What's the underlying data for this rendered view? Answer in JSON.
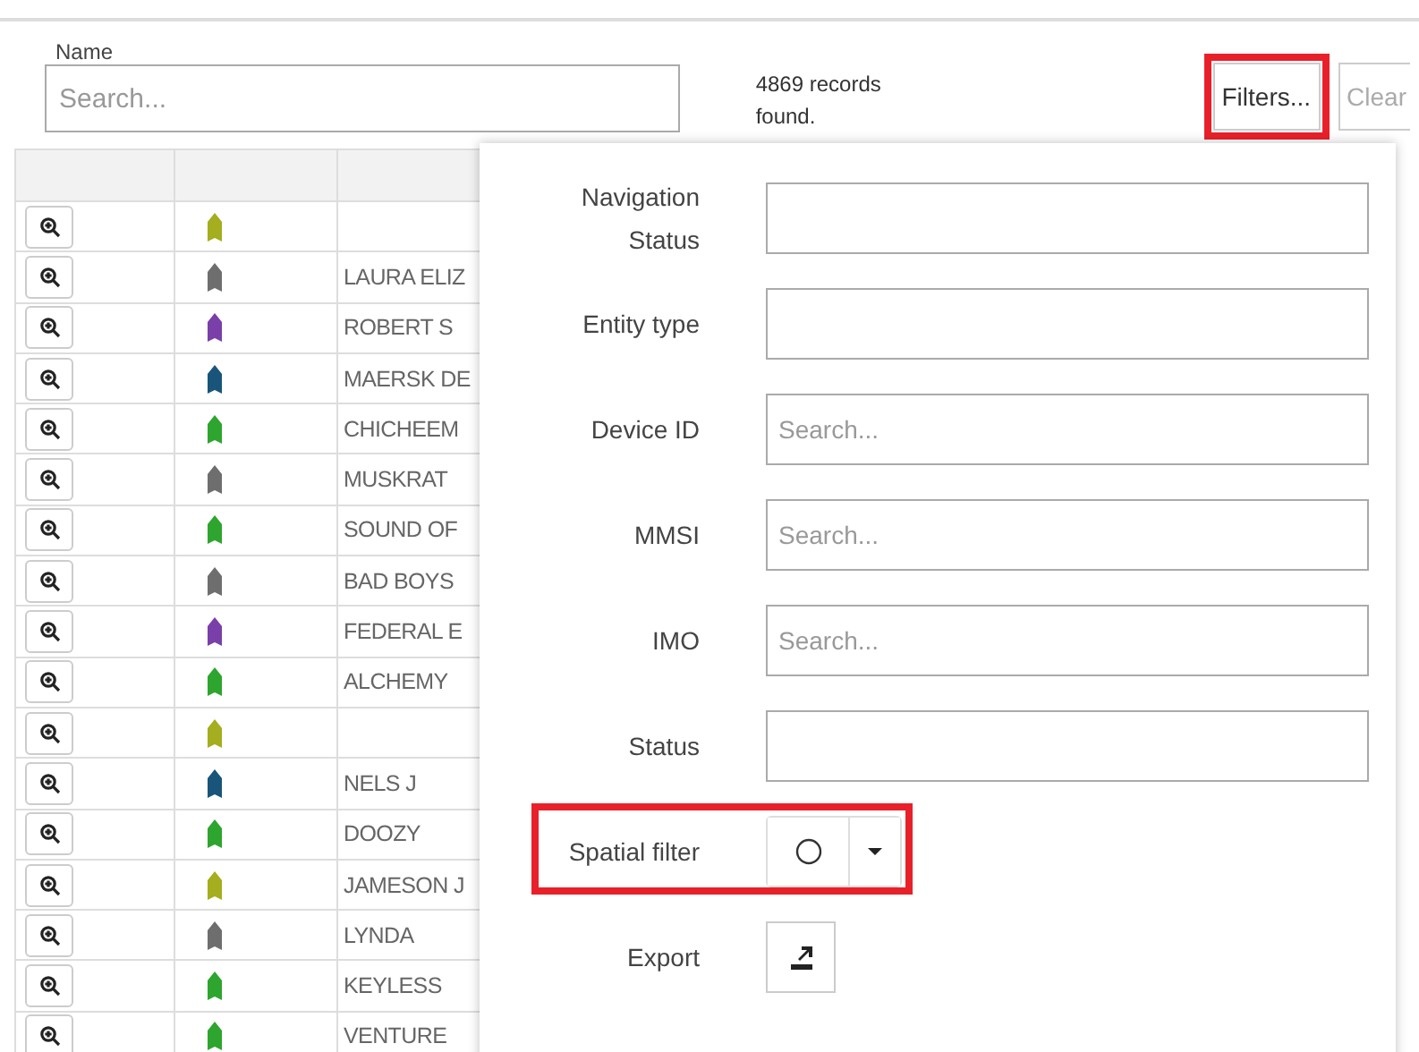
{
  "name_filter": {
    "label": "Name",
    "placeholder": "Search..."
  },
  "records": "4869 records found.",
  "toolbar": [
    {
      "label": "Filters...",
      "highlighted": true
    },
    {
      "label": "Clear",
      "highlighted": false
    }
  ],
  "table": {
    "rows": [
      {
        "name": "",
        "color": "#a4ae1e"
      },
      {
        "name": "LAURA ELIZ",
        "color": "#6e6e6e"
      },
      {
        "name": "ROBERT S",
        "color": "#7a3fa8"
      },
      {
        "name": "MAERSK DE",
        "color": "#19557a"
      },
      {
        "name": "CHICHEEM",
        "color": "#2ea52e"
      },
      {
        "name": "MUSKRAT",
        "color": "#6e6e6e"
      },
      {
        "name": "SOUND OF",
        "color": "#2ea52e"
      },
      {
        "name": "BAD BOYS",
        "color": "#6e6e6e"
      },
      {
        "name": "FEDERAL E",
        "color": "#7a3fa8"
      },
      {
        "name": "ALCHEMY",
        "color": "#2ea52e"
      },
      {
        "name": "",
        "color": "#a4ae1e"
      },
      {
        "name": "NELS J",
        "color": "#19557a"
      },
      {
        "name": "DOOZY",
        "color": "#2ea52e"
      },
      {
        "name": "JAMESON J",
        "color": "#a4ae1e"
      },
      {
        "name": "LYNDA",
        "color": "#6e6e6e"
      },
      {
        "name": "KEYLESS",
        "color": "#2ea52e"
      },
      {
        "name": "VENTURE",
        "color": "#2ea52e"
      }
    ]
  },
  "filters": [
    {
      "kind": "text",
      "label": "Navigation Status",
      "highlighted": false
    },
    {
      "kind": "text",
      "label": "Entity type",
      "highlighted": false
    },
    {
      "kind": "text",
      "label": "Device ID",
      "placeholder": "Search...",
      "highlighted": false
    },
    {
      "kind": "text",
      "label": "MMSI",
      "placeholder": "Search...",
      "highlighted": false
    },
    {
      "kind": "text",
      "label": "IMO",
      "placeholder": "Search...",
      "highlighted": false
    },
    {
      "kind": "text",
      "label": "Status",
      "highlighted": false
    },
    {
      "kind": "spatial",
      "label": "Spatial filter",
      "highlighted": true
    },
    {
      "kind": "export",
      "label": "Export",
      "highlighted": false
    }
  ]
}
